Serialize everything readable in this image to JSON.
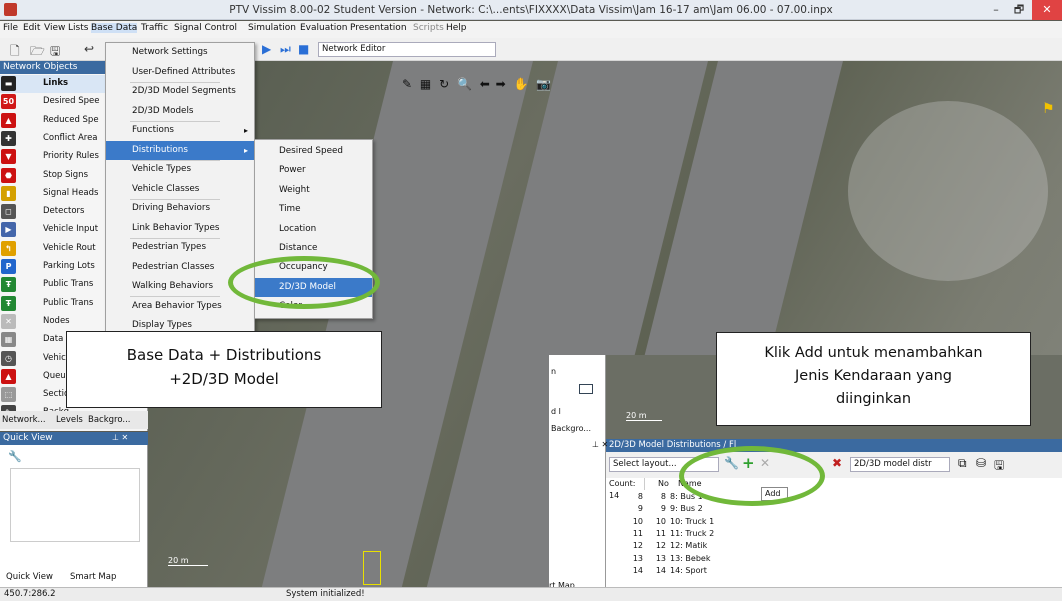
{
  "window": {
    "title": "PTV Vissim 8.00-02 Student Version - Network: C:\\...ents\\FIXXXX\\Data Vissim\\Jam 16-17 am\\Jam 06.00 - 07.00.inpx",
    "minimize": "–",
    "maximize": "🗗",
    "close": "✕"
  },
  "menubar": [
    "File",
    "Edit",
    "View",
    "Lists",
    "Base Data",
    "Traffic",
    "Signal Control",
    "Simulation",
    "Evaluation",
    "Presentation",
    "Scripts",
    "Help"
  ],
  "toolbar": {
    "network_editor": "Network Editor"
  },
  "net_objects": {
    "title": "Network Objects",
    "pin": "⊥ ✕",
    "items": [
      {
        "label": "Links",
        "color": "#222222",
        "glyph": "▬",
        "bold": true
      },
      {
        "label": "Desired Spee",
        "color": "#d01818",
        "glyph": "50"
      },
      {
        "label": "Reduced Spe",
        "color": "#cc1111",
        "glyph": "▲"
      },
      {
        "label": "Conflict Area",
        "color": "#333333",
        "glyph": "✚"
      },
      {
        "label": "Priority Rules",
        "color": "#cc1111",
        "glyph": "▼"
      },
      {
        "label": "Stop Signs",
        "color": "#cc1111",
        "glyph": "⬣"
      },
      {
        "label": "Signal Heads",
        "color": "#d4a000",
        "glyph": "▮"
      },
      {
        "label": "Detectors",
        "color": "#555555",
        "glyph": "◻"
      },
      {
        "label": "Vehicle Input",
        "color": "#4466aa",
        "glyph": "▶"
      },
      {
        "label": "Vehicle Rout",
        "color": "#e0a000",
        "glyph": "↰"
      },
      {
        "label": "Parking Lots",
        "color": "#2266cc",
        "glyph": "P"
      },
      {
        "label": "Public Trans",
        "color": "#228833",
        "glyph": "Ŧ"
      },
      {
        "label": "Public Trans",
        "color": "#228833",
        "glyph": "Ŧ"
      },
      {
        "label": "Nodes",
        "color": "#bbbbbb",
        "glyph": "✕"
      },
      {
        "label": "Data",
        "color": "#888888",
        "glyph": "▦"
      },
      {
        "label": "Vehic",
        "color": "#555555",
        "glyph": "◷"
      },
      {
        "label": "Queu",
        "color": "#cc1111",
        "glyph": "▲"
      },
      {
        "label": "Sectio",
        "color": "#999999",
        "glyph": "⬚"
      },
      {
        "label": "Backg",
        "color": "#444444",
        "glyph": "✎"
      }
    ],
    "tabs": [
      "Network...",
      "Levels",
      "Backgro..."
    ]
  },
  "quick_view": {
    "title": "Quick View",
    "pin": "⊥ ✕",
    "tabs": [
      "Quick View",
      "Smart Map"
    ]
  },
  "status": {
    "coords": "450.7:286.2",
    "message": "System initialized!"
  },
  "base_data_menu": {
    "items": [
      "Network Settings",
      "User-Defined Attributes",
      "2D/3D Model Segments",
      "2D/3D Models",
      "Functions",
      "Distributions",
      "Vehicle Types",
      "Vehicle Classes",
      "Driving Behaviors",
      "Link Behavior Types",
      "Pedestrian Types",
      "Pedestrian Classes",
      "Walking Behaviors",
      "Area Behavior Types",
      "Display Types"
    ],
    "selected": "Distributions",
    "submenu_arrow": "▸"
  },
  "distributions_menu": {
    "items": [
      "Desired Speed",
      "Power",
      "Weight",
      "Time",
      "Location",
      "Distance",
      "Occupancy",
      "2D/3D Model",
      "Color"
    ],
    "selected": "2D/3D Model"
  },
  "callouts": {
    "left": "Base Data + Distributions\n+2D/3D Model",
    "right": "Klik Add untuk menambahkan\nJenis Kendaraan yang\ndiinginkan"
  },
  "viewport": {
    "scale": "20 m"
  },
  "dock": {
    "title": "2D/3D Model Distributions / Fl",
    "pin": "⊥ ✕",
    "layout": "Select layout...",
    "model_select": "2D/3D model distr",
    "add_tooltip": "Add",
    "count_label": "Count: 14",
    "col_no": "No",
    "col_name": "Name",
    "rows": [
      {
        "idx": "8",
        "no": "8",
        "name": "8: Bus 1"
      },
      {
        "idx": "9",
        "no": "9",
        "name": "9: Bus 2"
      },
      {
        "idx": "10",
        "no": "10",
        "name": "10: Truck 1"
      },
      {
        "idx": "11",
        "no": "11",
        "name": "11: Truck 2"
      },
      {
        "idx": "12",
        "no": "12",
        "name": "12: Matik"
      },
      {
        "idx": "13",
        "no": "13",
        "name": "13: Bebek"
      },
      {
        "idx": "14",
        "no": "14",
        "name": "14: Sport"
      }
    ],
    "left_tabs": [
      "Backgro..."
    ],
    "left_labels": [
      "n",
      "d l"
    ],
    "smart_map": "rt Map",
    "scale": "20 m"
  }
}
